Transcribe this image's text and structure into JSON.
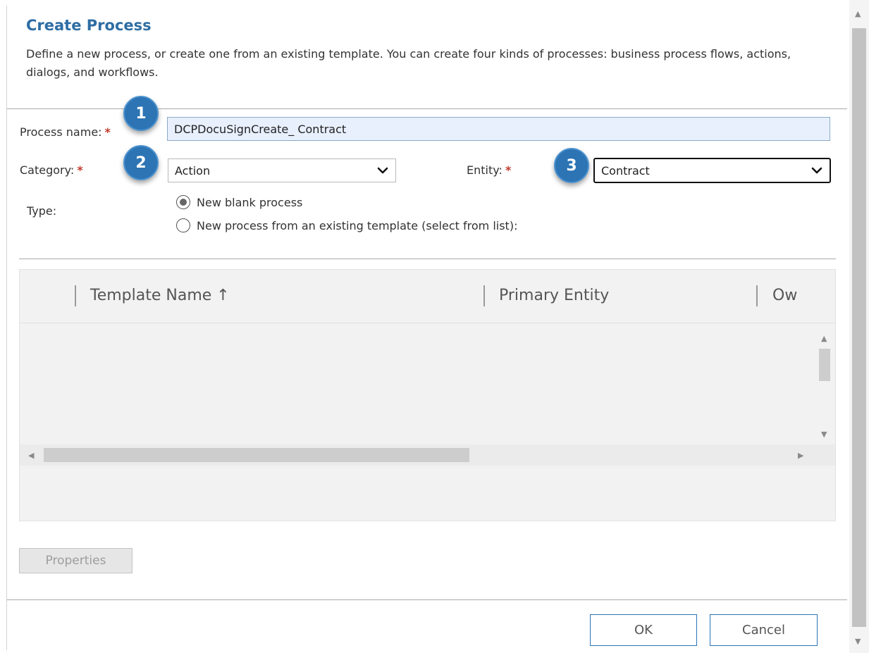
{
  "dialog": {
    "title": "Create Process",
    "description": "Define a new process, or create one from an existing template. You can create four kinds of processes: business process flows, actions, dialogs, and workflows."
  },
  "form": {
    "process_name_label": "Process name:",
    "process_name_value": "DCPDocuSignCreate_ Contract",
    "category_label": "Category:",
    "category_value": "Action",
    "entity_label": "Entity:",
    "entity_value": "Contract",
    "type_label": "Type:",
    "required_mark": "*",
    "type_options": [
      {
        "label": "New blank process",
        "selected": true
      },
      {
        "label": "New process from an existing template (select from list):",
        "selected": false
      }
    ]
  },
  "callouts": [
    "1",
    "2",
    "3"
  ],
  "grid": {
    "columns": [
      "Template Name ↑",
      "Primary Entity",
      "Ow"
    ]
  },
  "buttons": {
    "properties": "Properties",
    "ok": "OK",
    "cancel": "Cancel"
  },
  "colors": {
    "title": "#2e6da4",
    "callout": "#2c74b4",
    "required": "#c0392b",
    "input_bg": "#e8f0fe"
  }
}
